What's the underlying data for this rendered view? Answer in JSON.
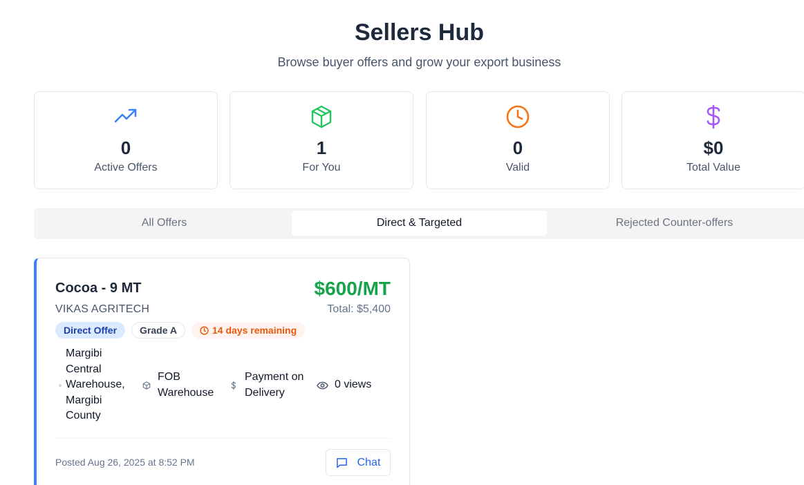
{
  "header": {
    "title": "Sellers Hub",
    "subtitle": "Browse buyer offers and grow your export business"
  },
  "stats": [
    {
      "icon": "trending-up-icon",
      "value": "0",
      "label": "Active Offers",
      "color": "#3b82f6"
    },
    {
      "icon": "package-icon",
      "value": "1",
      "label": "For You",
      "color": "#22c55e"
    },
    {
      "icon": "clock-icon",
      "value": "0",
      "label": "Valid",
      "color": "#f97316"
    },
    {
      "icon": "dollar-sign-icon",
      "value": "$0",
      "label": "Total Value",
      "color": "#a855f7"
    }
  ],
  "tabs": [
    {
      "label": "All Offers",
      "active": false
    },
    {
      "label": "Direct & Targeted",
      "active": true
    },
    {
      "label": "Rejected Counter-offers",
      "active": false
    }
  ],
  "offer": {
    "title": "Cocoa - 9 MT",
    "seller": "VIKAS AGRITECH",
    "price": "$600/MT",
    "total": "Total: $5,400",
    "badges": {
      "direct": "Direct Offer",
      "grade": "Grade A",
      "time": "14 days remaining"
    },
    "details": {
      "location": "Margibi Central Warehouse, Margibi County",
      "incoterm": "FOB Warehouse",
      "payment": "Payment on Delivery",
      "views": "0 views"
    },
    "posted": "Posted Aug 26, 2025 at 8:52 PM",
    "chat_label": "Chat"
  },
  "colors": {
    "accent": "#3b82f6",
    "price": "#16a34a",
    "badge_direct_bg": "#dbeafe",
    "badge_time": "#ea580c"
  }
}
